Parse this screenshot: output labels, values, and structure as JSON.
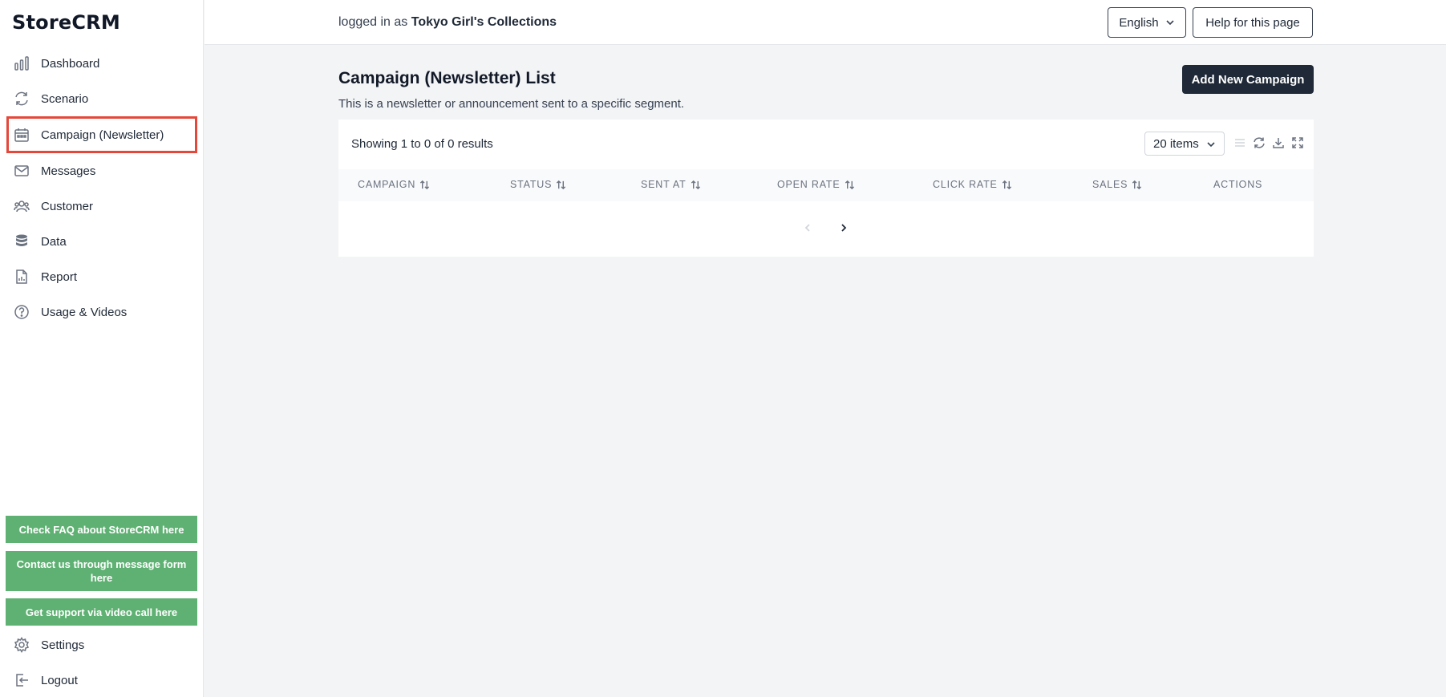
{
  "app": {
    "logo": "StoreCRM"
  },
  "sidebar": {
    "items": [
      {
        "label": "Dashboard",
        "icon": "bar-chart-icon"
      },
      {
        "label": "Scenario",
        "icon": "refresh-icon"
      },
      {
        "label": "Campaign (Newsletter)",
        "icon": "calendar-icon",
        "active": true
      },
      {
        "label": "Messages",
        "icon": "mail-icon"
      },
      {
        "label": "Customer",
        "icon": "users-icon"
      },
      {
        "label": "Data",
        "icon": "database-icon"
      },
      {
        "label": "Report",
        "icon": "document-chart-icon"
      },
      {
        "label": "Usage & Videos",
        "icon": "question-circle-icon"
      }
    ],
    "support_buttons": [
      "Check FAQ about StoreCRM here",
      "Contact us through message form here",
      "Get support via video call here"
    ],
    "settings_label": "Settings",
    "logout_label": "Logout"
  },
  "header": {
    "logged_in_prefix": "logged in as",
    "store_name": "Tokyo Girl's Collections",
    "language": "English",
    "help_label": "Help for this page"
  },
  "main": {
    "title": "Campaign (Newsletter) List",
    "description": "This is a newsletter or announcement sent to a specific segment.",
    "add_button": "Add New Campaign",
    "table": {
      "showing": "Showing 1 to 0 of 0 results",
      "page_size": "20 items",
      "columns": [
        "CAMPAIGN",
        "STATUS",
        "SENT AT",
        "OPEN RATE",
        "CLICK RATE",
        "SALES",
        "ACTIONS"
      ]
    }
  },
  "colors": {
    "accent_dark": "#1f2937",
    "support_green": "#5fb173",
    "active_border": "#e5483b"
  }
}
